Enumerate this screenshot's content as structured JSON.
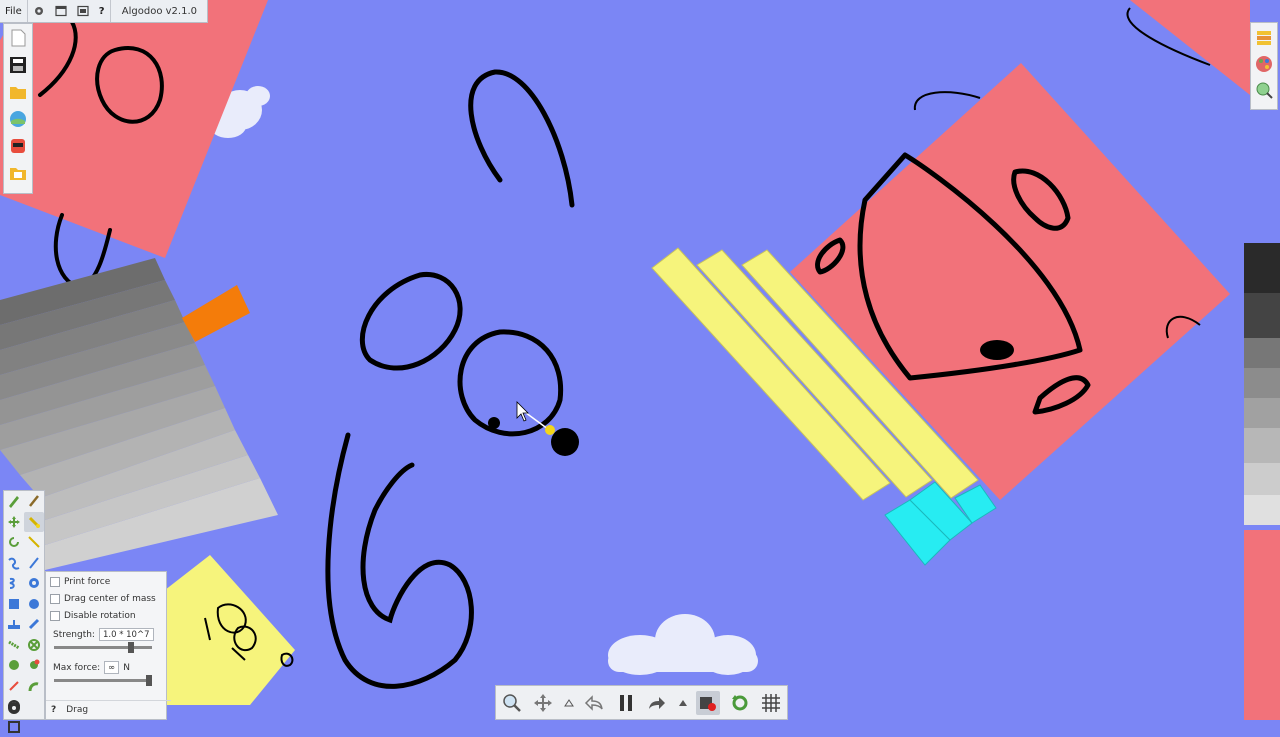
{
  "app": {
    "title": "Algodoo v2.1.0",
    "menu": {
      "file_label": "File",
      "help_label": "?"
    }
  },
  "left_toolbar": {
    "icons": [
      "new-scene-icon",
      "save-icon",
      "open-folder-icon",
      "phunlets-icon",
      "character-icon",
      "browse-scenes-icon"
    ]
  },
  "right_toolbar": {
    "icons": [
      "layers-icon",
      "palette-icon",
      "zoom-to-fit-icon"
    ]
  },
  "tool_palette": {
    "tools": [
      "sketch-tool",
      "brush-tool",
      "move-tool",
      "drag-tool",
      "rotate-tool",
      "cut-tool",
      "rope-tool",
      "laser-tool",
      "spring-tool",
      "gear-tool",
      "box-tool",
      "circle-tool",
      "plane-tool",
      "pen-tool",
      "chain-tool",
      "fixate-tool",
      "thruster-tool",
      "tracer-tool",
      "hinge-tool",
      "axle-tool",
      "spawn-tool",
      "",
      "scale-tool",
      ""
    ],
    "active": "drag-tool"
  },
  "drag_options": {
    "print_force_label": "Print force",
    "drag_center_label": "Drag center of mass",
    "disable_rotation_label": "Disable rotation",
    "strength_label": "Strength:",
    "strength_value": "1.0 * 10^7",
    "strength_level": 0.8,
    "max_force_label": "Max force:",
    "max_force_value": "∞",
    "max_force_unit": "N",
    "max_force_level": 1.0,
    "help_label": "?",
    "tool_label": "Drag"
  },
  "bottom_toolbar": {
    "buttons": [
      "zoom-button",
      "pan-button",
      "undo-more-arrow",
      "undo-button",
      "pause-button",
      "redo-button",
      "redo-more-arrow",
      "record-button",
      "reset-button",
      "grid-button"
    ]
  },
  "colors": {
    "background": "#7b86f5",
    "red_box": "#f2727a",
    "yellow": "#f6f47c",
    "cyan": "#27ecf2",
    "orange": "#f47c0a",
    "gray": "#888888",
    "sketch": "#000000"
  }
}
